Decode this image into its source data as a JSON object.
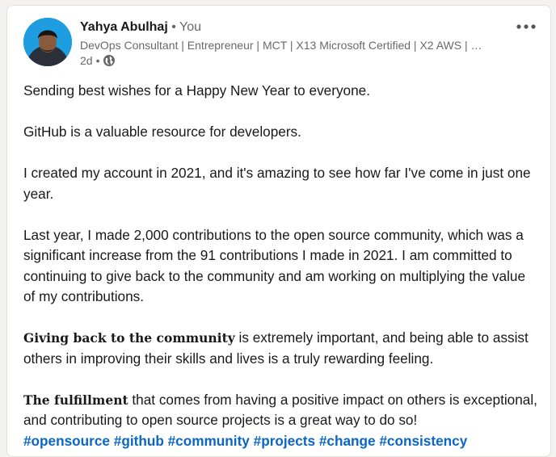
{
  "post": {
    "author": {
      "name": "Yahya Abulhaj",
      "separator": "•",
      "relation": "You",
      "headline": "DevOps Consultant | Entrepreneur | MCT | X13 Microsoft Certified | X2 AWS | …",
      "time": "2d",
      "time_separator": "•",
      "visibility_icon": "globe-icon"
    },
    "menu_icon": "more-horizontal-icon",
    "paragraphs": {
      "p1": "Sending best wishes for a Happy New Year to everyone.",
      "p2": "GitHub is a valuable resource for developers.",
      "p3": "I created my account in 2021, and it's amazing to see how far I've come in just one year.",
      "p4": "Last year, I made 2,000 contributions to the open source community, which was a significant increase from the 91 contributions I made in 2021. I am committed to continuing to give back to the community and am working on multiplying the value of my contributions.",
      "p5_bold": "Giving back to the community",
      "p5_rest": " is extremely important, and being able to assist others in improving their skills and lives is a truly rewarding feeling.",
      "p6_bold": "The fulfillment",
      "p6_rest": " that comes from having a positive impact on others is exceptional, and contributing to open source projects is a great way to do so!"
    },
    "hashtags": [
      "#opensource",
      "#github",
      "#community",
      "#projects",
      "#change",
      "#consistency"
    ],
    "colors": {
      "link": "#0a66c2",
      "text": "#191919",
      "muted": "#666666"
    }
  }
}
